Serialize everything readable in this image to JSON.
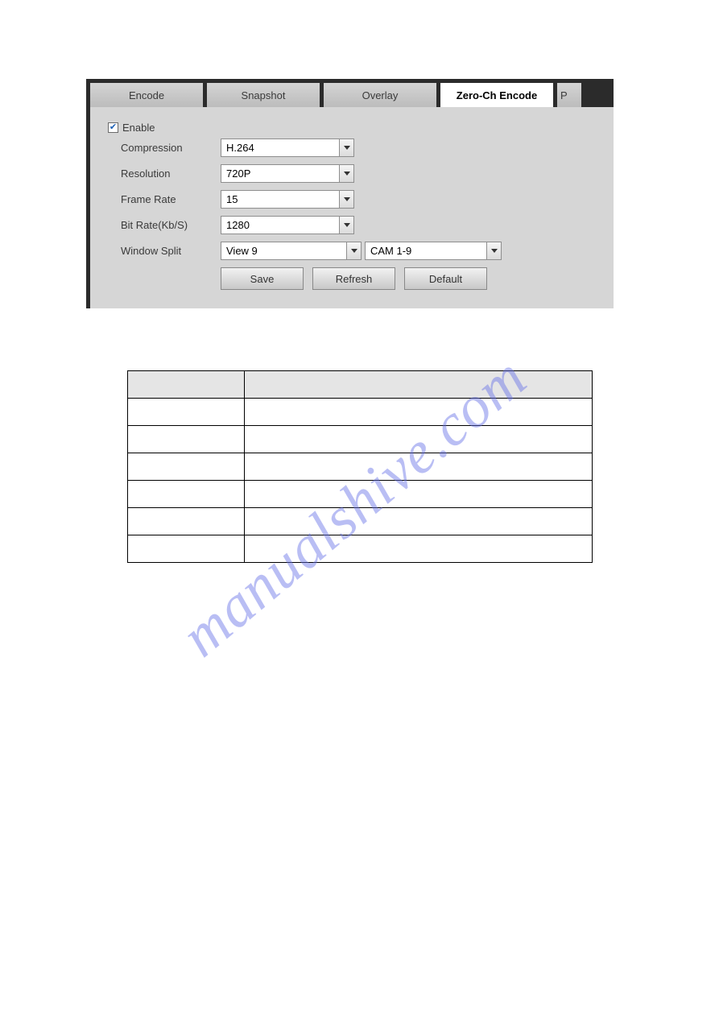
{
  "tabs": {
    "encode": "Encode",
    "snapshot": "Snapshot",
    "overlay": "Overlay",
    "zero": "Zero-Ch Encode",
    "p": "P"
  },
  "form": {
    "enable_label": "Enable",
    "compression": {
      "label": "Compression",
      "value": "H.264"
    },
    "resolution": {
      "label": "Resolution",
      "value": "720P"
    },
    "frame_rate": {
      "label": "Frame Rate",
      "value": "15"
    },
    "bit_rate": {
      "label": "Bit Rate(Kb/S)",
      "value": "1280"
    },
    "window_split": {
      "label": "Window Split",
      "value": "View 9",
      "cam": "CAM 1-9"
    }
  },
  "buttons": {
    "save": "Save",
    "refresh": "Refresh",
    "default": "Default"
  },
  "watermark": "manualshive.com"
}
